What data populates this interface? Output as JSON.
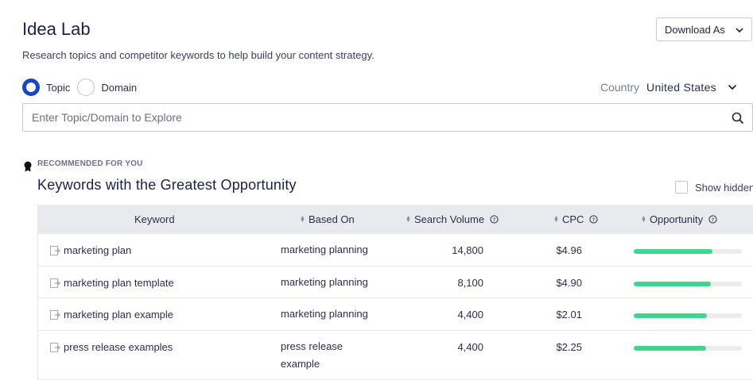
{
  "header": {
    "title": "Idea Lab",
    "subtitle": "Research topics and competitor keywords to help build your content strategy.",
    "download_label": "Download As"
  },
  "mode": {
    "options": [
      {
        "label": "Topic",
        "selected": true
      },
      {
        "label": "Domain",
        "selected": false
      }
    ]
  },
  "country": {
    "label": "Country",
    "value": "United States"
  },
  "search": {
    "placeholder": "Enter Topic/Domain to Explore",
    "value": ""
  },
  "recommended": {
    "eyebrow": "RECOMMENDED FOR YOU",
    "title": "Keywords with the Greatest Opportunity",
    "show_hidden_label": "Show hidden",
    "show_hidden_checked": false
  },
  "table": {
    "columns": {
      "keyword": "Keyword",
      "based_on": "Based On",
      "search_volume": "Search Volume",
      "cpc": "CPC",
      "opportunity": "Opportunity"
    },
    "rows": [
      {
        "keyword": "marketing plan",
        "based_on": "marketing planning",
        "search_volume": "14,800",
        "cpc": "$4.96",
        "opportunity": 0.73
      },
      {
        "keyword": "marketing plan template",
        "based_on": "marketing planning",
        "search_volume": "8,100",
        "cpc": "$4.90",
        "opportunity": 0.71
      },
      {
        "keyword": "marketing plan example",
        "based_on": "marketing planning",
        "search_volume": "4,400",
        "cpc": "$2.01",
        "opportunity": 0.68
      },
      {
        "keyword": "press release examples",
        "based_on": "press release example",
        "search_volume": "4,400",
        "cpc": "$2.25",
        "opportunity": 0.67
      }
    ]
  },
  "colors": {
    "accent": "#1546c7",
    "opportunity_bar": "#3fd68b",
    "header_bg": "#e9eaee"
  }
}
